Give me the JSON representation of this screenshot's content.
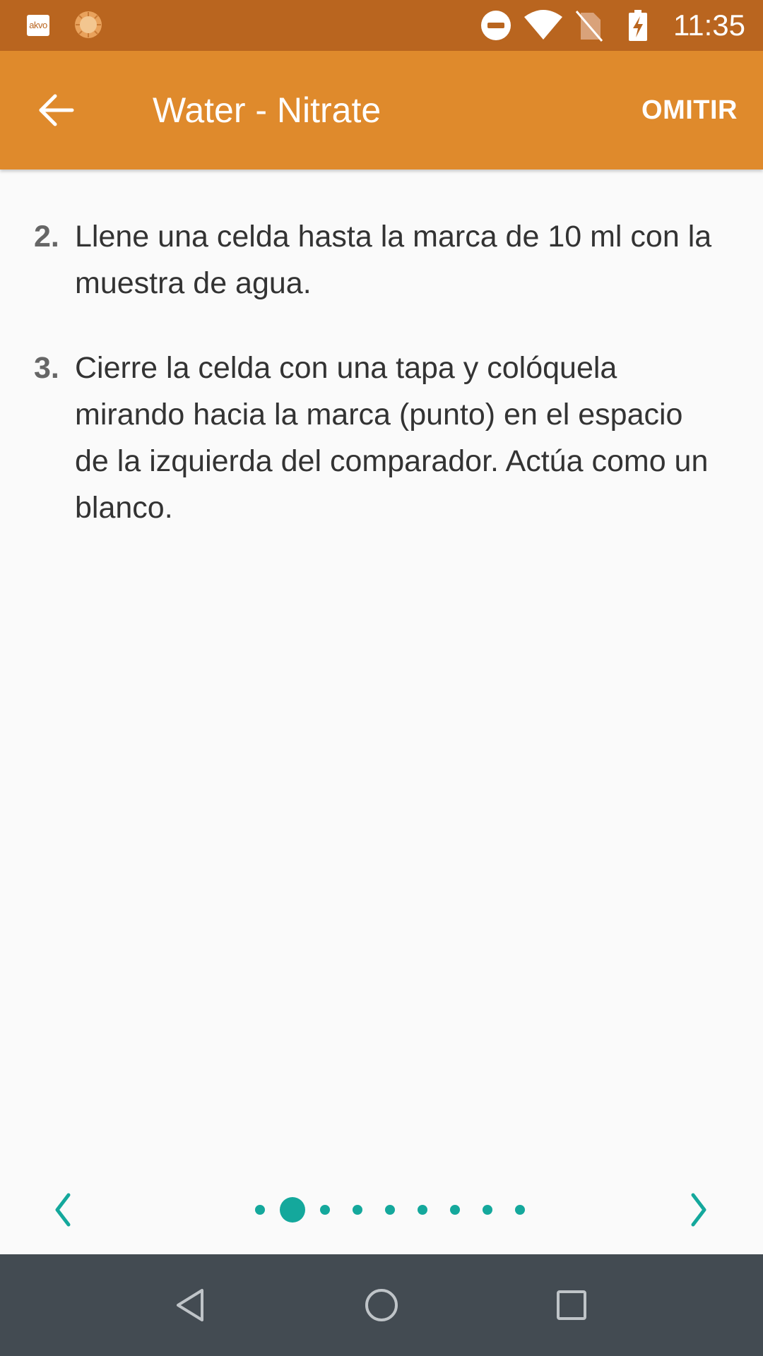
{
  "status_bar": {
    "app_icon_text": "akvo",
    "time": "11:35",
    "icons": [
      "akvo-app-icon",
      "sun-app-icon",
      "do-not-disturb-icon",
      "wifi-icon",
      "no-sim-icon",
      "battery-charging-icon"
    ]
  },
  "app_bar": {
    "title": "Water - Nitrate",
    "back_icon": "arrow-left-icon",
    "skip_label": "OMITIR",
    "background": "#df8a2c"
  },
  "steps": [
    {
      "number": "2.",
      "text": "Llene una celda hasta la marca de 10 ml con la muestra de agua."
    },
    {
      "number": "3.",
      "text": "Cierre la celda con una tapa y colóquela mirando hacia la marca (punto) en el espacio de la izquierda del comparador. Actúa como un blanco."
    }
  ],
  "pager": {
    "page_count": 9,
    "current_page": 2,
    "prev_icon": "chevron-left-icon",
    "next_icon": "chevron-right-icon",
    "accent": "#14a89c"
  },
  "nav_bar": {
    "buttons": [
      "back-triangle-icon",
      "home-circle-icon",
      "recents-square-icon"
    ]
  }
}
